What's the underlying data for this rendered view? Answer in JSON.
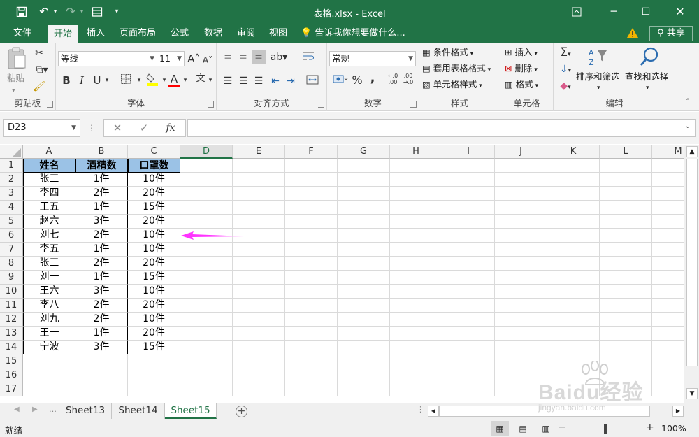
{
  "title_bar": {
    "title": "表格.xlsx - Excel"
  },
  "menu": {
    "tabs": [
      "文件",
      "开始",
      "插入",
      "页面布局",
      "公式",
      "数据",
      "审阅",
      "视图"
    ],
    "active_index": 1,
    "tell_me": "告诉我你想要做什么...",
    "share": "共享"
  },
  "ribbon": {
    "clipboard": {
      "label": "剪贴板",
      "paste": "粘贴"
    },
    "font": {
      "label": "字体",
      "name": "等线",
      "size": "11",
      "bold": "B",
      "italic": "I",
      "underline": "U",
      "grow": "A",
      "shrink": "A",
      "font_color": "A",
      "phonetic": "文"
    },
    "alignment": {
      "label": "对齐方式"
    },
    "number": {
      "label": "数字",
      "format": "常规",
      "percent": "%",
      "comma": ","
    },
    "styles": {
      "label": "样式",
      "conditional": "条件格式",
      "table": "套用表格格式",
      "cell": "单元格样式"
    },
    "cells": {
      "label": "单元格",
      "insert": "插入",
      "delete": "删除",
      "format": "格式"
    },
    "editing": {
      "label": "编辑",
      "sort": "排序和筛选",
      "find": "查找和选择",
      "sum": "Σ"
    }
  },
  "formula_bar": {
    "name_box": "D23",
    "fx": "fx",
    "value": ""
  },
  "grid": {
    "columns": [
      "A",
      "B",
      "C",
      "D",
      "E",
      "F",
      "G",
      "H",
      "I",
      "J",
      "K",
      "L",
      "M"
    ],
    "highlighted_column": "D",
    "row_numbers": [
      "1",
      "2",
      "3",
      "4",
      "5",
      "6",
      "7",
      "8",
      "9",
      "10",
      "11",
      "12",
      "13",
      "14",
      "15",
      "16",
      "17"
    ],
    "header_row": [
      "姓名",
      "酒精数",
      "口罩数"
    ],
    "header_fill": "#9bc2e6",
    "data_rows": [
      [
        "张三",
        "1件",
        "10件"
      ],
      [
        "李四",
        "2件",
        "20件"
      ],
      [
        "王五",
        "1件",
        "15件"
      ],
      [
        "赵六",
        "3件",
        "20件"
      ],
      [
        "刘七",
        "2件",
        "10件"
      ],
      [
        "李五",
        "1件",
        "10件"
      ],
      [
        "张三",
        "2件",
        "20件"
      ],
      [
        "刘一",
        "1件",
        "15件"
      ],
      [
        "王六",
        "3件",
        "10件"
      ],
      [
        "李八",
        "2件",
        "20件"
      ],
      [
        "刘九",
        "2件",
        "10件"
      ],
      [
        "王一",
        "1件",
        "20件"
      ],
      [
        "宁波",
        "3件",
        "15件"
      ]
    ],
    "arrow_color": "#ff33ff"
  },
  "sheets": {
    "tabs": [
      "Sheet13",
      "Sheet14",
      "Sheet15"
    ],
    "active": "Sheet15"
  },
  "status": {
    "ready": "就绪",
    "zoom": "100%"
  },
  "watermark": {
    "line1": "Baidu经验",
    "line2": "jingyan.baidu.com"
  }
}
